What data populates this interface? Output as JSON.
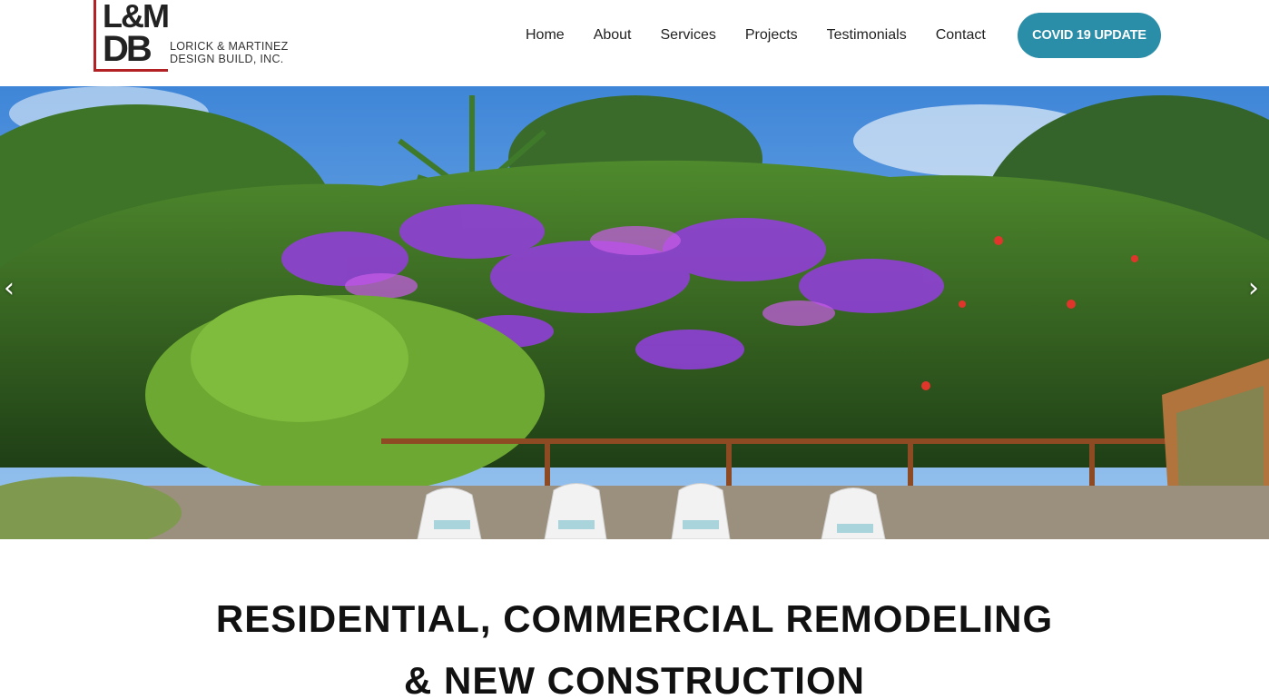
{
  "header": {
    "logo": {
      "monogram_top": "L&M",
      "monogram_bottom": "DB",
      "name_line1": "LORICK & MARTINEZ",
      "name_line2": "DESIGN BUILD, INC.",
      "accent_color": "#b32125"
    },
    "nav": [
      {
        "label": "Home"
      },
      {
        "label": "About"
      },
      {
        "label": "Services"
      },
      {
        "label": "Projects"
      },
      {
        "label": "Testimonials"
      },
      {
        "label": "Contact"
      }
    ],
    "cta": {
      "label": "COVID 19 UPDATE",
      "color": "#2b8ea8"
    }
  },
  "hero": {
    "prev_icon": "chevron-left-icon",
    "next_icon": "chevron-right-icon"
  },
  "main": {
    "headline_line1": "RESIDENTIAL, COMMERCIAL REMODELING",
    "headline_line2": "& NEW CONSTRUCTION"
  }
}
